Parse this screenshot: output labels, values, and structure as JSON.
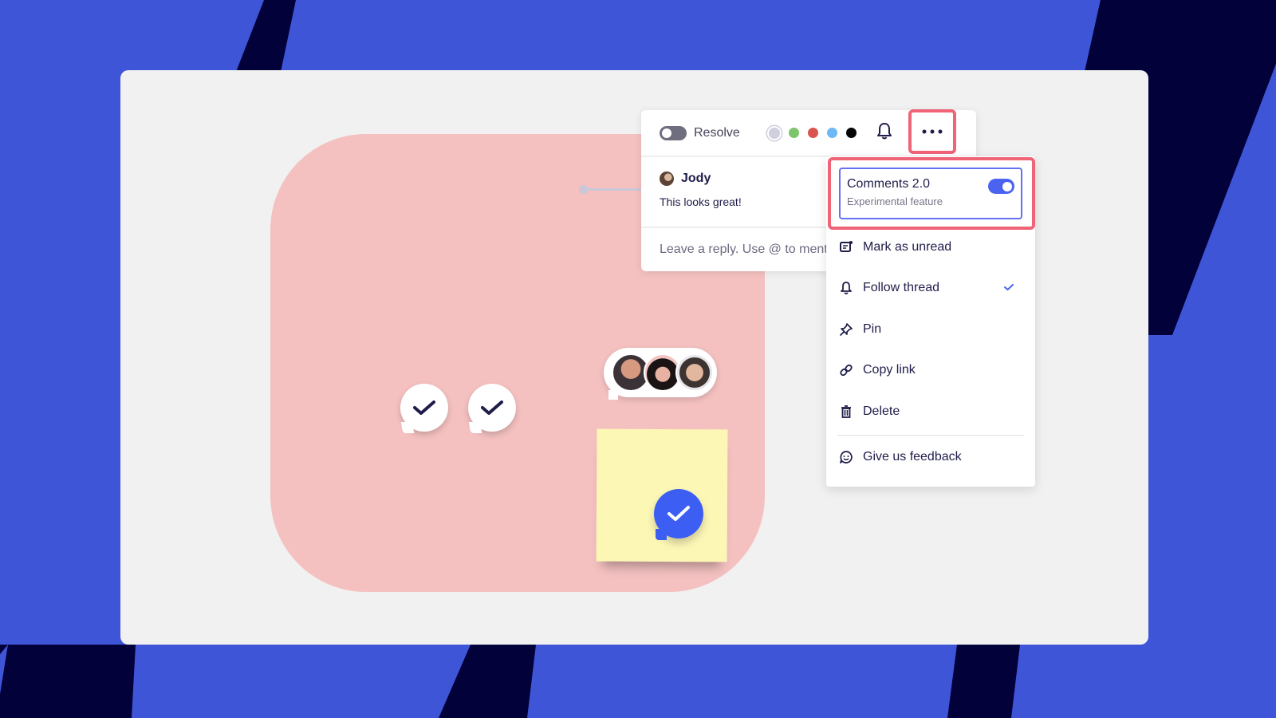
{
  "colors": {
    "background_blue": "#3f55d8",
    "background_navy": "#03013a",
    "canvas": "#f1f1f1",
    "shape_pink": "#f4c1c0",
    "sticky_yellow": "#fdf7b6",
    "accent_blue": "#3d5ef2",
    "highlight_red": "#f06478",
    "text_dark": "#1f1d4a"
  },
  "comment_toolbar": {
    "resolve_label": "Resolve",
    "resolve_on": false,
    "color_options": [
      {
        "name": "gray",
        "hex": "#cfcfdd",
        "selected": true
      },
      {
        "name": "green",
        "hex": "#7cc56a",
        "selected": false
      },
      {
        "name": "red",
        "hex": "#d9534f",
        "selected": false
      },
      {
        "name": "light-blue",
        "hex": "#6eb8f5",
        "selected": false
      },
      {
        "name": "black",
        "hex": "#050505",
        "selected": false
      }
    ],
    "bell_icon": "bell-icon",
    "more_icon": "more-horizontal-icon"
  },
  "comment": {
    "author": "Jody",
    "text": "This looks great!",
    "reply_placeholder": "Leave a reply. Use @ to mention"
  },
  "menu": {
    "feature": {
      "title": "Comments 2.0",
      "subtitle": "Experimental feature",
      "enabled": true
    },
    "items": [
      {
        "label": "Mark as unread",
        "icon": "mark-unread-icon",
        "checked": false
      },
      {
        "label": "Follow thread",
        "icon": "bell-icon",
        "checked": true
      },
      {
        "label": "Pin",
        "icon": "pin-icon",
        "checked": false
      },
      {
        "label": "Copy link",
        "icon": "link-icon",
        "checked": false
      },
      {
        "label": "Delete",
        "icon": "trash-icon",
        "checked": false
      }
    ],
    "footer_item": {
      "label": "Give us feedback",
      "icon": "feedback-icon"
    }
  },
  "canvas": {
    "resolved_comment_markers": 2,
    "participant_avatars": 3,
    "sticky_note_marker": "resolved-check"
  }
}
